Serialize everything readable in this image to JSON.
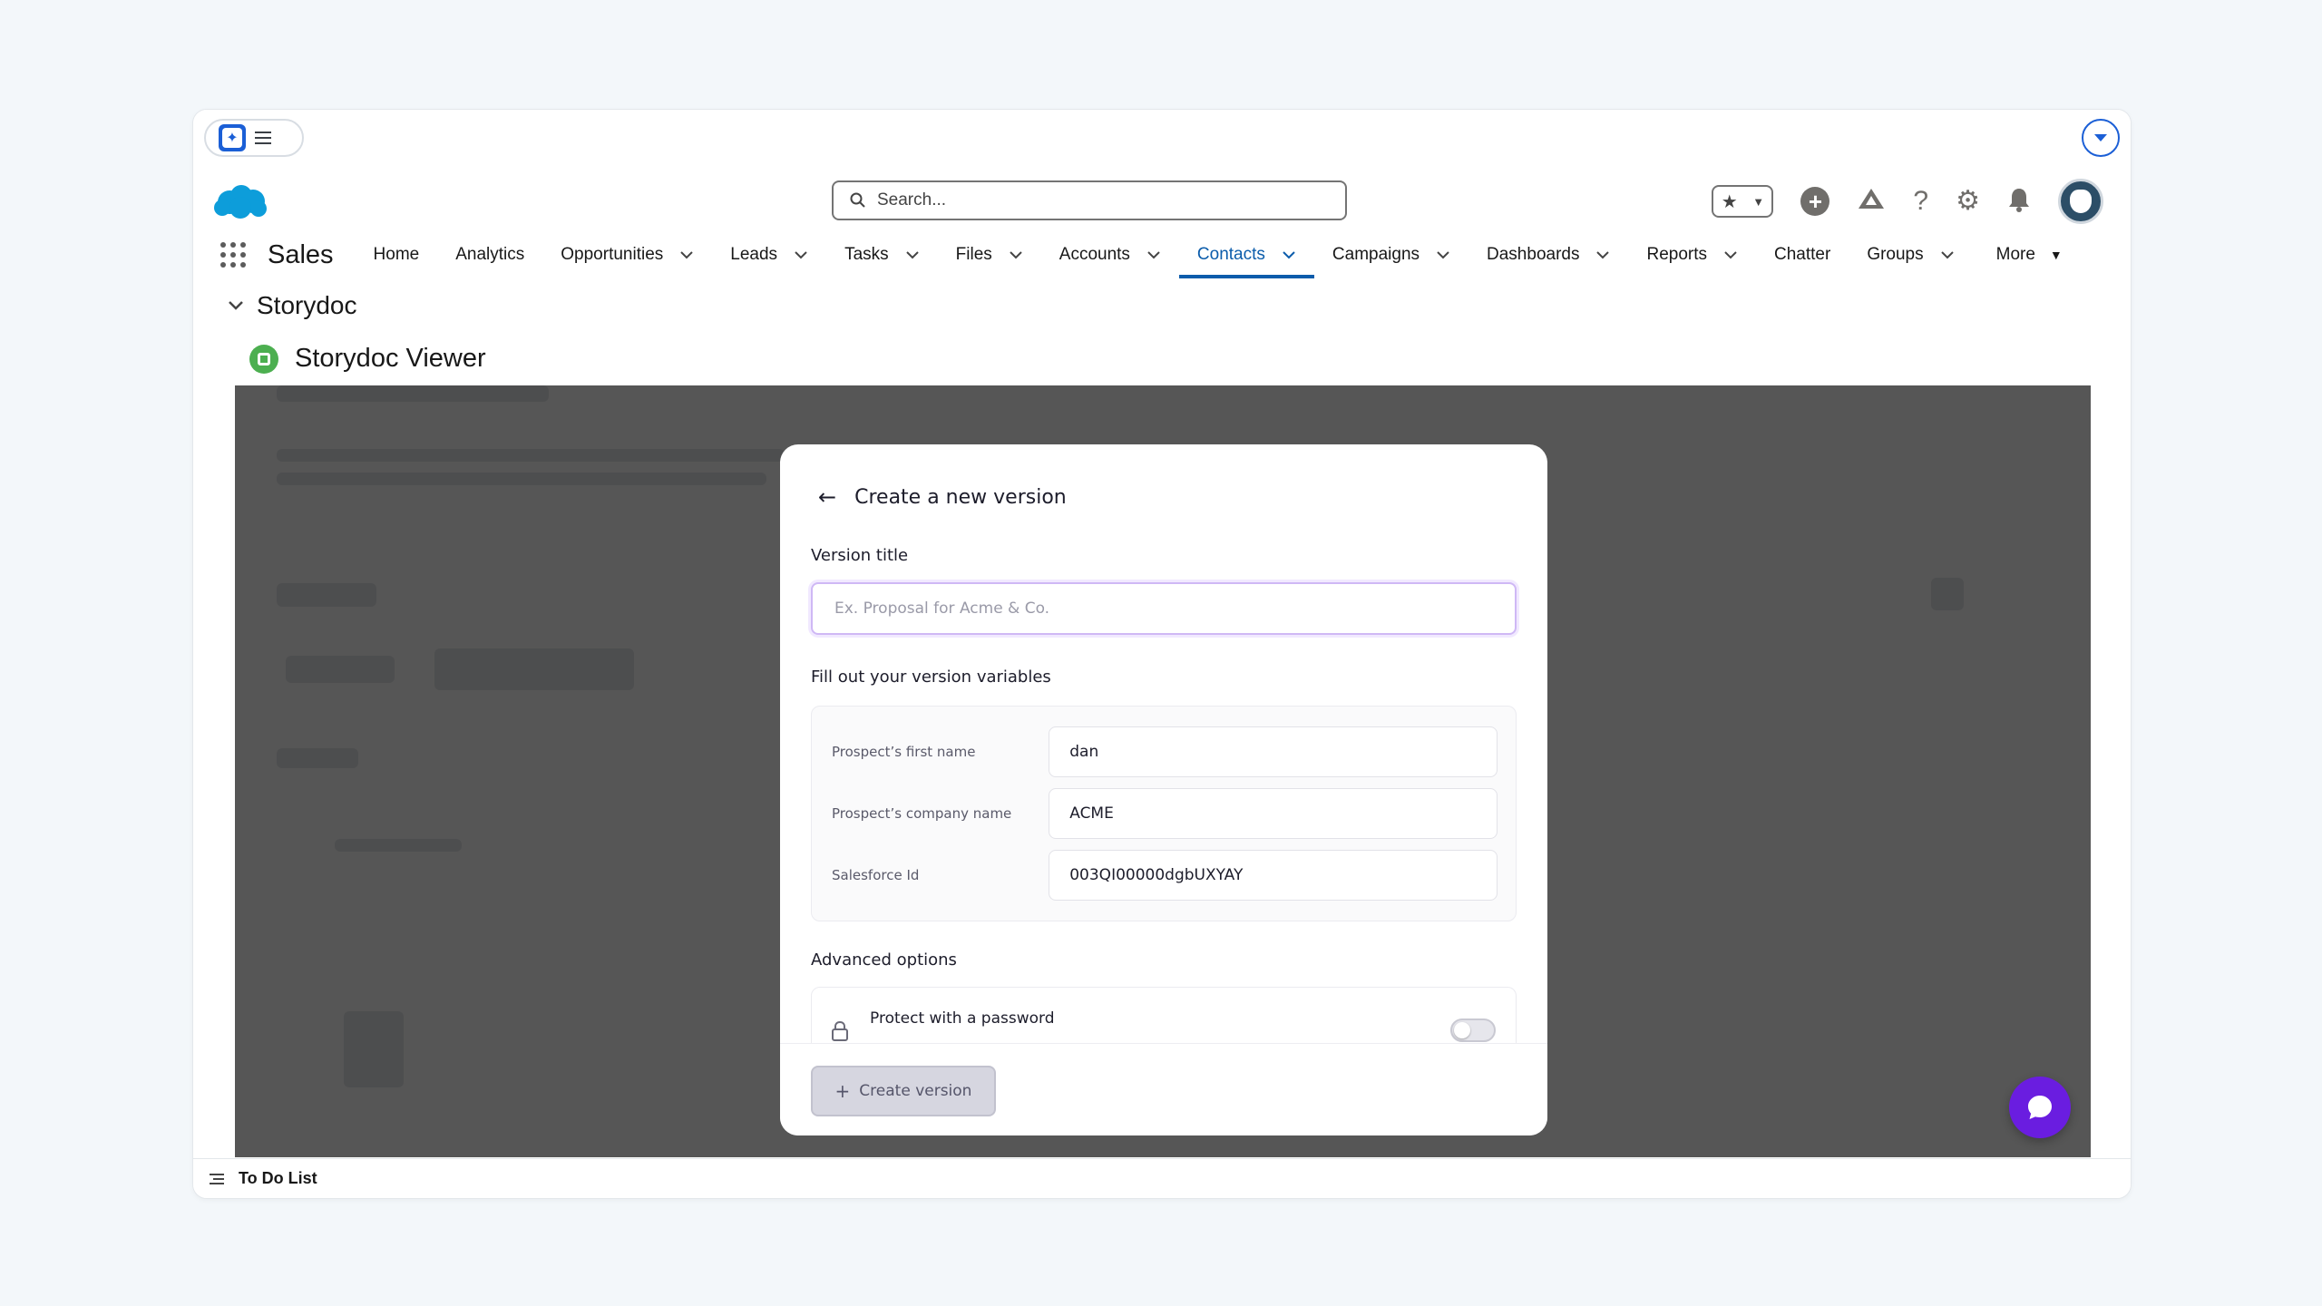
{
  "header": {
    "search_placeholder": "Search...",
    "app_name": "Sales"
  },
  "nav": {
    "items": [
      {
        "label": "Home",
        "has_menu": false
      },
      {
        "label": "Analytics",
        "has_menu": false
      },
      {
        "label": "Opportunities",
        "has_menu": true
      },
      {
        "label": "Leads",
        "has_menu": true
      },
      {
        "label": "Tasks",
        "has_menu": true
      },
      {
        "label": "Files",
        "has_menu": true
      },
      {
        "label": "Accounts",
        "has_menu": true
      },
      {
        "label": "Contacts",
        "has_menu": true,
        "active": true
      },
      {
        "label": "Campaigns",
        "has_menu": true
      },
      {
        "label": "Dashboards",
        "has_menu": true
      },
      {
        "label": "Reports",
        "has_menu": true
      },
      {
        "label": "Chatter",
        "has_menu": false
      },
      {
        "label": "Groups",
        "has_menu": true
      }
    ],
    "more_label": "More"
  },
  "section": {
    "storydoc_label": "Storydoc",
    "viewer_title": "Storydoc Viewer"
  },
  "modal": {
    "title": "Create a new version",
    "version_title_label": "Version title",
    "version_title_placeholder": "Ex. Proposal for Acme & Co.",
    "variables_label": "Fill out your version variables",
    "variables": [
      {
        "label": "Prospect’s first name",
        "value": "dan"
      },
      {
        "label": "Prospect’s company name",
        "value": "ACME"
      },
      {
        "label": "Salesforce Id",
        "value": "003QI00000dgbUXYAY"
      }
    ],
    "advanced_label": "Advanced options",
    "password_label": "Protect with a password",
    "create_button": "Create version"
  },
  "dock": {
    "todo_label": "To Do List"
  },
  "colors": {
    "brand_blue": "#0b5cab",
    "chat_purple": "#6a1de0",
    "salesforce_cloud": "#0d9dda"
  }
}
